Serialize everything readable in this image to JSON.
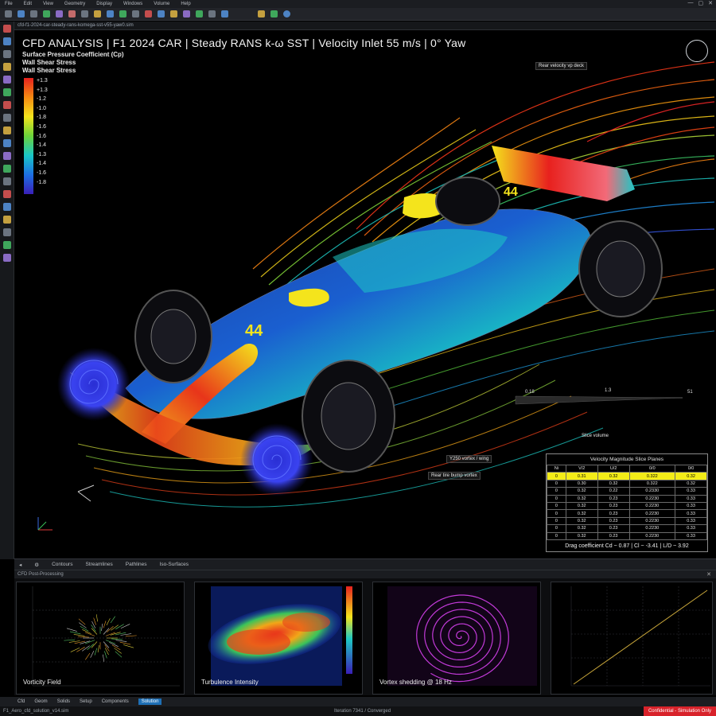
{
  "menu": {
    "items": [
      "File",
      "Edit",
      "View",
      "Geometry",
      "Display",
      "Windows",
      "Volume",
      "Help"
    ],
    "window_buttons": [
      "—",
      "▢",
      "✕"
    ]
  },
  "address": {
    "text": "cfd-f1-2024-car-steady-rans-komega-sst-v55-yaw0.sim"
  },
  "viewport": {
    "title": "CFD ANALYSIS | F1 2024 CAR | Steady RANS k-ω SST | Velocity Inlet 55 m/s | 0° Yaw",
    "legend": {
      "title1": "Surface Pressure Coefficient (Cp)",
      "title2": "Wall Shear Stress",
      "title3": "Wall Shear Stress",
      "ticks": [
        "+1.3",
        "+1.3",
        "-1.2",
        "-1.0",
        "-1.8",
        "-1.6",
        "-1.6",
        "-1.4",
        "-1.3",
        "-1.4",
        "-1.6",
        "-1.8"
      ]
    },
    "car_number": "44",
    "callouts": {
      "top_right": "Rear velocity vp deck",
      "scale_left": "0.18",
      "scale_mid": "1.3",
      "scale_right": "51",
      "slice_label": "Slice volume",
      "vortex_label": "Y250 vortex / wing",
      "front_vortex_label": "Rear tire bump vortex"
    },
    "table": {
      "title": "Velocity Magnitude Slice Planes",
      "rows": [
        [
          "Ni",
          "V/2",
          "U/2",
          "0/0",
          "0/0"
        ],
        [
          "0",
          "0.31",
          "0.32",
          "0.322",
          "0.32"
        ],
        [
          "0",
          "0.30",
          "0.32",
          "0.322",
          "0.32"
        ],
        [
          "0",
          "0.32",
          "0.22",
          "0.2330",
          "0.33"
        ],
        [
          "0",
          "0.32",
          "0.23",
          "0.2230",
          "0.33"
        ],
        [
          "0",
          "0.32",
          "0.23",
          "0.2230",
          "0.33"
        ],
        [
          "0",
          "0.32",
          "0.23",
          "0.2230",
          "0.33"
        ],
        [
          "0",
          "0.32",
          "0.23",
          "0.2230",
          "0.33"
        ],
        [
          "0",
          "0.32",
          "0.23",
          "0.2230",
          "0.33"
        ],
        [
          "0",
          "0.32",
          "0.23",
          "0.2230",
          "0.33"
        ]
      ],
      "highlight_row": 1,
      "footer": "Drag coefficient Cd ~ 0.87 | Cl ~ -3.41 | L/D ~ 3.92"
    }
  },
  "viewport_tabs": [
    "Contours",
    "Streamlines",
    "Pathlines",
    "Iso-Surfaces"
  ],
  "bottom_panel": {
    "header": "CFD Post-Processing",
    "plots": [
      {
        "label": "Vorticity Field"
      },
      {
        "label": "Turbulence Intensity"
      },
      {
        "label": "Vortex shedding @ 18 Hz"
      },
      {
        "label": ""
      }
    ]
  },
  "status_tabs": [
    "Cfd",
    "Geom",
    "Solids",
    "Setup",
    "Components",
    "Solution"
  ],
  "footer": {
    "left": "F1_Aero_cfd_solution_v14.sim",
    "mid": "Iteration 7341 / Converged",
    "right": "Confidential - Simulation Only"
  },
  "colors": {
    "streamline_warm": "#ff5a1a",
    "legend_high": "#e8211e",
    "legend_low": "#3a1fb8",
    "highlight": "#f3ec18",
    "status_active": "#1e6fb5",
    "footer_alert": "#d8222a"
  }
}
